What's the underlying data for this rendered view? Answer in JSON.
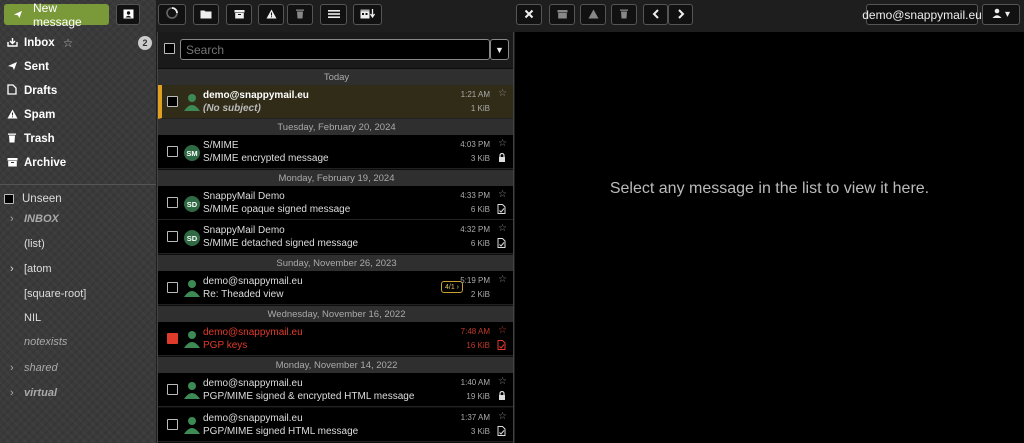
{
  "toolbar": {
    "new_message_label": "New message",
    "user_email": "demo@snappymail.eu",
    "user_menu_caret": "▾"
  },
  "sidebar": {
    "folders": [
      {
        "label": "Inbox",
        "icon": "inbox-icon",
        "badge": "2"
      },
      {
        "label": "Sent",
        "icon": "send-icon"
      },
      {
        "label": "Drafts",
        "icon": "document-icon"
      },
      {
        "label": "Spam",
        "icon": "warning-icon"
      },
      {
        "label": "Trash",
        "icon": "trash-icon"
      },
      {
        "label": "Archive",
        "icon": "archive-icon"
      }
    ],
    "unseen_label": "Unseen",
    "subfolders": [
      {
        "label": "INBOX",
        "chevron": "›"
      },
      {
        "label": "(list)"
      },
      {
        "label": "[atom",
        "chevron": "›"
      },
      {
        "label": "[square-root]"
      },
      {
        "label": "NIL"
      },
      {
        "label": "notexists"
      },
      {
        "label": "shared",
        "chevron": "›"
      },
      {
        "label": "virtual",
        "chevron": "›"
      }
    ]
  },
  "search": {
    "placeholder": "Search",
    "drop_symbol": "▼"
  },
  "messages": {
    "date_groups": [
      "Today",
      "Tuesday, February 20, 2024",
      "Monday, February 19, 2024",
      "Sunday, November 26, 2023",
      "Wednesday, November 16, 2022",
      "Monday, November 14, 2022"
    ],
    "rows": [
      {
        "sender": "demo@snappymail.eu",
        "subject": "(No subject)",
        "time": "1:21 AM",
        "size": "1 KiB"
      },
      {
        "sender": "S/MIME",
        "subject": "S/MIME encrypted message",
        "time": "4:03 PM",
        "size": "3 KiB",
        "avatar": "SM"
      },
      {
        "sender": "SnappyMail Demo",
        "subject": "S/MIME opaque signed message",
        "time": "4:33 PM",
        "size": "6 KiB",
        "avatar": "SD"
      },
      {
        "sender": "SnappyMail Demo",
        "subject": "S/MIME detached signed message",
        "time": "4:32 PM",
        "size": "6 KiB",
        "avatar": "SD"
      },
      {
        "sender": "demo@snappymail.eu",
        "subject": "Re: Theaded view",
        "time": "5:19 PM",
        "size": "2 KiB",
        "thread": "4/1 ›"
      },
      {
        "sender": "demo@snappymail.eu",
        "subject": "PGP keys",
        "time": "7:48 AM",
        "size": "16 KiB"
      },
      {
        "sender": "demo@snappymail.eu",
        "subject": "PGP/MIME signed & encrypted HTML message",
        "time": "1:40 AM",
        "size": "19 KiB"
      },
      {
        "sender": "demo@snappymail.eu",
        "subject": "PGP/MIME signed HTML message",
        "time": "1:37 AM",
        "size": "3 KiB"
      }
    ]
  },
  "preview": {
    "empty_text": "Select any message in the list to view it here."
  },
  "colors": {
    "accent_green": "#7a9a3a",
    "selected_row": "#302c18",
    "selected_border": "#e0a020",
    "flagged_red": "#e03a2a",
    "avatar_green": "#2f6a44"
  }
}
